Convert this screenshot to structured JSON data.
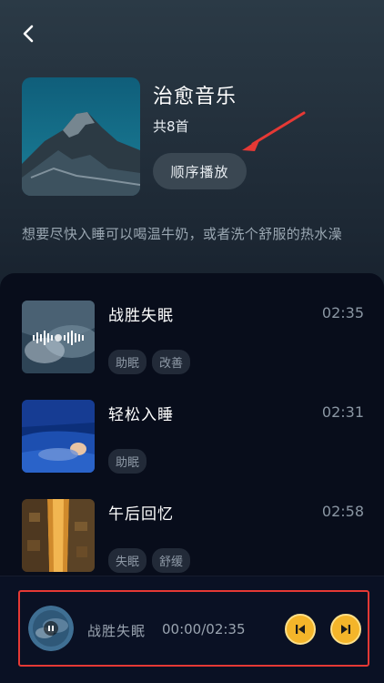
{
  "album": {
    "title": "治愈音乐",
    "count": "共8首",
    "play_label": "顺序播放",
    "description": "想要尽快入睡可以喝温牛奶，或者洗个舒服的热水澡"
  },
  "tracks": [
    {
      "title": "战胜失眠",
      "duration": "02:35",
      "tags": [
        "助眠",
        "改善"
      ]
    },
    {
      "title": "轻松入睡",
      "duration": "02:31",
      "tags": [
        "助眠"
      ]
    },
    {
      "title": "午后回忆",
      "duration": "02:58",
      "tags": [
        "失眠",
        "舒缓"
      ]
    }
  ],
  "player": {
    "title": "战胜失眠",
    "time": "00:00/02:35"
  },
  "icons": {
    "back": "chevron-left-icon",
    "prev": "skip-previous-icon",
    "next": "skip-next-icon",
    "pause": "pause-icon"
  },
  "colors": {
    "accent": "#f4b52a",
    "highlight": "#e53935"
  }
}
